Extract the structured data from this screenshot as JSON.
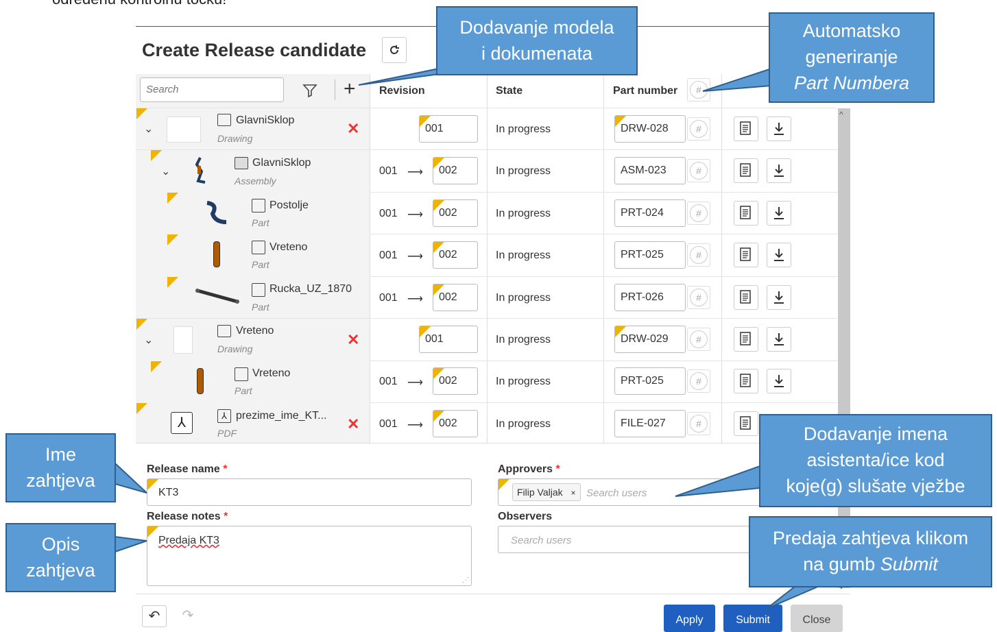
{
  "top_text": "određenu kontrolnu točku!",
  "dialog": {
    "title": "Create Release candidate",
    "search_placeholder": "Search",
    "headers": {
      "revision": "Revision",
      "state": "State",
      "part_number": "Part number"
    }
  },
  "rows": [
    {
      "name": "GlavniSklop",
      "type": "Drawing",
      "old_rev": "",
      "arrow": "",
      "new_rev": "001",
      "state": "In progress",
      "part_number": "DRW-028"
    },
    {
      "name": "GlavniSklop",
      "type": "Assembly",
      "old_rev": "001",
      "arrow": "⟶",
      "new_rev": "002",
      "state": "In progress",
      "part_number": "ASM-023"
    },
    {
      "name": "Postolje",
      "type": "Part",
      "old_rev": "001",
      "arrow": "⟶",
      "new_rev": "002",
      "state": "In progress",
      "part_number": "PRT-024"
    },
    {
      "name": "Vreteno",
      "type": "Part",
      "old_rev": "001",
      "arrow": "⟶",
      "new_rev": "002",
      "state": "In progress",
      "part_number": "PRT-025"
    },
    {
      "name": "Rucka_UZ_1870",
      "type": "Part",
      "old_rev": "001",
      "arrow": "⟶",
      "new_rev": "002",
      "state": "In progress",
      "part_number": "PRT-026"
    },
    {
      "name": "Vreteno",
      "type": "Drawing",
      "old_rev": "",
      "arrow": "",
      "new_rev": "001",
      "state": "In progress",
      "part_number": "DRW-029"
    },
    {
      "name": "Vreteno",
      "type": "Part",
      "old_rev": "001",
      "arrow": "⟶",
      "new_rev": "002",
      "state": "In progress",
      "part_number": "PRT-025"
    },
    {
      "name": "prezime_ime_KT...",
      "type": "PDF",
      "old_rev": "001",
      "arrow": "⟶",
      "new_rev": "002",
      "state": "In progress",
      "part_number": "FILE-027"
    }
  ],
  "form": {
    "release_name_label": "Release name",
    "release_name_value": "KT3",
    "release_notes_label": "Release notes",
    "release_notes_value": "Predaja KT3",
    "approvers_label": "Approvers",
    "approver_chip": "Filip Valjak",
    "approvers_placeholder": "Search users",
    "observers_label": "Observers",
    "observers_placeholder": "Search users",
    "required_mark": "*"
  },
  "buttons": {
    "apply": "Apply",
    "submit": "Submit",
    "close": "Close"
  },
  "callouts": {
    "add_models": [
      "Dodavanje modela",
      "i dokumenata"
    ],
    "auto_gen": [
      "Automatsko",
      "generiranje",
      "Part Numbera"
    ],
    "release_name": [
      "Ime",
      "zahtjeva"
    ],
    "description": [
      "Opis",
      "zahtjeva"
    ],
    "assistant": [
      "Dodavanje imena",
      "asistenta/ice kod",
      "koje(g) slušate vježbe"
    ],
    "submit": [
      "Predaja zahtjeva klikom",
      "na gumb ",
      "Submit"
    ]
  },
  "colors": {
    "accent_blue": "#1f5fbf",
    "callout_fill": "#5b9bd5",
    "marker_yellow": "#f0b400",
    "remove_red": "#e33333"
  }
}
